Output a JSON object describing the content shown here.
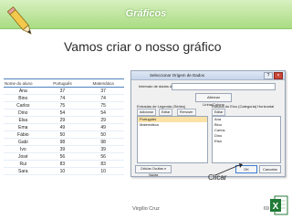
{
  "slide": {
    "banner_title": "Gráficos",
    "title": "Vamos criar o nosso gráfico",
    "author": "Virgílio Cruz",
    "page_number": "69",
    "callout": "Clicar"
  },
  "table": {
    "headers": [
      "Nome do aluno",
      "Português",
      "Matemática"
    ],
    "rows": [
      [
        "Ana",
        "37",
        "37"
      ],
      [
        "Bino",
        "74",
        "74"
      ],
      [
        "Carlos",
        "75",
        "75"
      ],
      [
        "Dino",
        "54",
        "54"
      ],
      [
        "Elsa",
        "29",
        "29"
      ],
      [
        "Ema",
        "49",
        "49"
      ],
      [
        "Fábio",
        "50",
        "50"
      ],
      [
        "Gabi",
        "98",
        "98"
      ],
      [
        "Ivo",
        "39",
        "39"
      ],
      [
        "José",
        "56",
        "56"
      ],
      [
        "Rui",
        "83",
        "83"
      ],
      [
        "Sara",
        "10",
        "10"
      ]
    ]
  },
  "dialog": {
    "title": "Seleccionar Origem de Dados",
    "range_label": "Intervalo de dados do gráfico:",
    "switch_label": "Alternar Linha/Coluna",
    "series_label": "Entradas de Legenda (Séries)",
    "axis_label": "Rótulos do Eixo (Categoria) Horizontal",
    "add_label": "Adicionar",
    "edit_label": "Editar",
    "remove_label": "Remover",
    "series_items": [
      "Português",
      "Matemática"
    ],
    "axis_items": [
      "Ana",
      "Bino",
      "Carlos",
      "Dino",
      "Elsa"
    ],
    "hidden_label": "Células Ocultas e Vazias",
    "ok_label": "OK",
    "cancel_label": "Cancelar"
  }
}
